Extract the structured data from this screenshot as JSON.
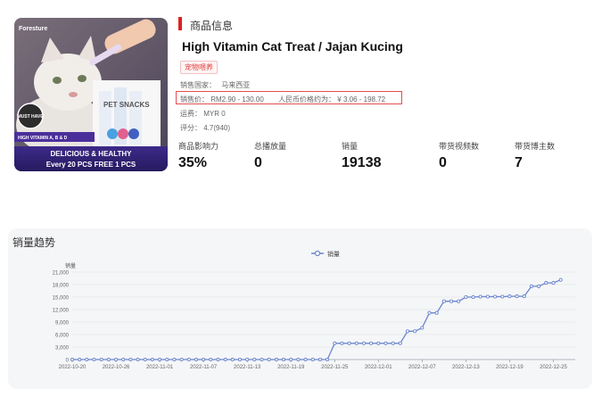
{
  "product": {
    "image": {
      "brand": "Foresture",
      "badge": "MUST HAVE",
      "vitamin_text": "HIGH VITAMIN A, B & D",
      "banner_line1": "DELICIOUS & HEALTHY",
      "banner_line2": "Every 20 PCS FREE 1 PCS",
      "pack_label": "PET SNACKS"
    },
    "section_title": "商品信息",
    "title": "High Vitamin Cat Treat / Jajan Kucing",
    "category_tag": "宠物喂养",
    "country_label": "销售国家：",
    "country_value": "马来西亚",
    "price_label": "销售价：",
    "price_value": "RM2.90 - 130.00",
    "rmb_label": "人民币价格约为：",
    "rmb_value": "¥ 3.06 - 198.72",
    "shipping_label": "运费：",
    "shipping_value": "MYR 0",
    "rating_label": "评分：",
    "rating_value": "4.7(940)"
  },
  "stats": [
    {
      "label": "商品影响力",
      "value": "35%"
    },
    {
      "label": "总播放量",
      "value": "0"
    },
    {
      "label": "销量",
      "value": "19138"
    },
    {
      "label": "带货视频数",
      "value": "0"
    },
    {
      "label": "带货博主数",
      "value": "7"
    }
  ],
  "trend": {
    "title": "销量趋势"
  },
  "colors": {
    "accent": "#e02020",
    "line": "#6b86cc"
  },
  "chart_data": {
    "type": "line",
    "legend": "销量",
    "ylabel": "销量",
    "ylim": [
      0,
      21000
    ],
    "y_ticks": [
      "21,000",
      "18,000",
      "15,000",
      "12,000",
      "9,000",
      "6,000",
      "3,000",
      "0"
    ],
    "x_tick_labels": [
      "2022-10-20",
      "2022-10-26",
      "2022-11-01",
      "2022-11-07",
      "2022-11-13",
      "2022-11-19",
      "2022-11-25",
      "2022-12-01",
      "2022-12-07",
      "2022-12-13",
      "2022-12-19",
      "2022-12-25"
    ],
    "x_start": "2022-10-20",
    "x_end": "2022-12-28",
    "series": [
      {
        "name": "销量",
        "points": [
          [
            "2022-10-20",
            0
          ],
          [
            "2022-10-21",
            0
          ],
          [
            "2022-10-22",
            0
          ],
          [
            "2022-10-23",
            0
          ],
          [
            "2022-10-24",
            0
          ],
          [
            "2022-10-25",
            0
          ],
          [
            "2022-10-26",
            0
          ],
          [
            "2022-10-27",
            0
          ],
          [
            "2022-10-28",
            0
          ],
          [
            "2022-10-29",
            0
          ],
          [
            "2022-10-30",
            0
          ],
          [
            "2022-10-31",
            0
          ],
          [
            "2022-11-01",
            0
          ],
          [
            "2022-11-02",
            0
          ],
          [
            "2022-11-03",
            0
          ],
          [
            "2022-11-04",
            0
          ],
          [
            "2022-11-05",
            0
          ],
          [
            "2022-11-06",
            0
          ],
          [
            "2022-11-07",
            0
          ],
          [
            "2022-11-08",
            0
          ],
          [
            "2022-11-09",
            0
          ],
          [
            "2022-11-10",
            0
          ],
          [
            "2022-11-11",
            0
          ],
          [
            "2022-11-12",
            0
          ],
          [
            "2022-11-13",
            0
          ],
          [
            "2022-11-14",
            0
          ],
          [
            "2022-11-15",
            0
          ],
          [
            "2022-11-16",
            0
          ],
          [
            "2022-11-17",
            0
          ],
          [
            "2022-11-18",
            0
          ],
          [
            "2022-11-19",
            0
          ],
          [
            "2022-11-20",
            0
          ],
          [
            "2022-11-21",
            0
          ],
          [
            "2022-11-22",
            0
          ],
          [
            "2022-11-23",
            0
          ],
          [
            "2022-11-24",
            0
          ],
          [
            "2022-11-25",
            3900
          ],
          [
            "2022-11-26",
            3900
          ],
          [
            "2022-11-27",
            3900
          ],
          [
            "2022-11-28",
            3900
          ],
          [
            "2022-11-29",
            3900
          ],
          [
            "2022-11-30",
            3900
          ],
          [
            "2022-12-01",
            3900
          ],
          [
            "2022-12-02",
            3900
          ],
          [
            "2022-12-03",
            3900
          ],
          [
            "2022-12-04",
            3900
          ],
          [
            "2022-12-05",
            6800
          ],
          [
            "2022-12-06",
            6800
          ],
          [
            "2022-12-07",
            7600
          ],
          [
            "2022-12-08",
            11200
          ],
          [
            "2022-12-09",
            11200
          ],
          [
            "2022-12-10",
            14000
          ],
          [
            "2022-12-11",
            14000
          ],
          [
            "2022-12-12",
            14000
          ],
          [
            "2022-12-13",
            15000
          ],
          [
            "2022-12-14",
            15000
          ],
          [
            "2022-12-15",
            15100
          ],
          [
            "2022-12-16",
            15100
          ],
          [
            "2022-12-17",
            15100
          ],
          [
            "2022-12-18",
            15100
          ],
          [
            "2022-12-19",
            15200
          ],
          [
            "2022-12-20",
            15200
          ],
          [
            "2022-12-21",
            15200
          ],
          [
            "2022-12-22",
            17600
          ],
          [
            "2022-12-23",
            17600
          ],
          [
            "2022-12-24",
            18400
          ],
          [
            "2022-12-25",
            18400
          ],
          [
            "2022-12-26",
            19138
          ]
        ]
      }
    ]
  }
}
